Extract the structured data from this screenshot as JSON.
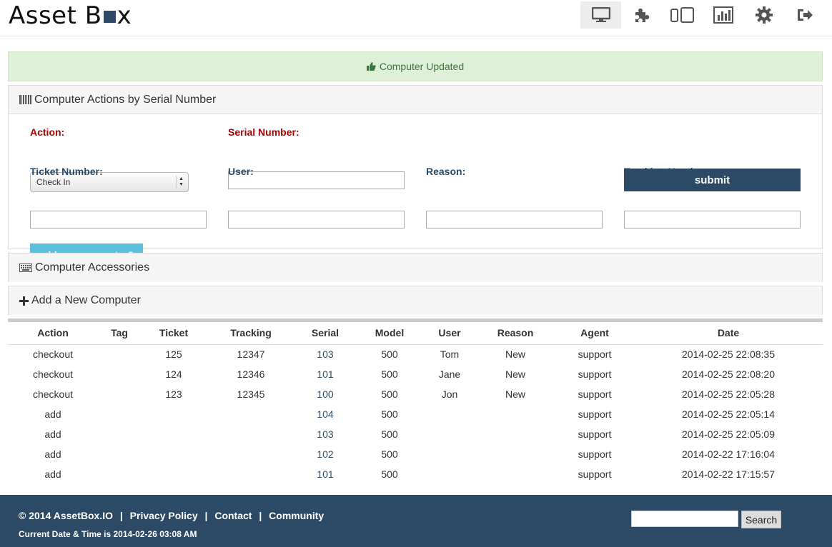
{
  "brand": {
    "name_prefix": "Asset B",
    "name_suffix": "x"
  },
  "nav": {
    "items": [
      {
        "icon": "desktop-icon",
        "active": true
      },
      {
        "icon": "puzzle-icon",
        "active": false
      },
      {
        "icon": "tablet-icon",
        "active": false
      },
      {
        "icon": "bar-chart-icon",
        "active": false
      },
      {
        "icon": "gear-icon",
        "active": false
      },
      {
        "icon": "sign-out-icon",
        "active": false
      }
    ]
  },
  "alert": {
    "text": "Computer Updated",
    "icon": "thumbs-up-icon",
    "color": "#3c763d",
    "background": "#dff0d8"
  },
  "panel_actions": {
    "title": "Computer Actions by Serial Number",
    "icon": "barcode-icon",
    "action_label": "Action:",
    "action_value": "Check In",
    "serial_label": "Serial Number:",
    "ticket_label": "Ticket Number:",
    "user_label": "User:",
    "reason_label": "Reason:",
    "tracking_label": "Tracking Number:",
    "submit_label": "submit",
    "add_label": "add new computer?"
  },
  "panel_accessories": {
    "title": "Computer Accessories",
    "icon": "keyboard-icon"
  },
  "panel_new": {
    "title": "Add a New Computer",
    "icon": "plus-icon"
  },
  "table": {
    "headers": [
      "Action",
      "Tag",
      "Ticket",
      "Tracking",
      "Serial",
      "Model",
      "User",
      "Reason",
      "Agent",
      "Date"
    ],
    "rows": [
      [
        "checkout",
        "",
        "125",
        "12347",
        "103",
        "500",
        "Tom",
        "New",
        "support",
        "2014-02-25 22:08:35"
      ],
      [
        "checkout",
        "",
        "124",
        "12346",
        "101",
        "500",
        "Jane",
        "New",
        "support",
        "2014-02-25 22:08:20"
      ],
      [
        "checkout",
        "",
        "123",
        "12345",
        "100",
        "500",
        "Jon",
        "New",
        "support",
        "2014-02-25 22:05:28"
      ],
      [
        "add",
        "",
        "",
        "",
        "104",
        "500",
        "",
        "",
        "support",
        "2014-02-25 22:05:14"
      ],
      [
        "add",
        "",
        "",
        "",
        "103",
        "500",
        "",
        "",
        "support",
        "2014-02-25 22:05:09"
      ],
      [
        "add",
        "",
        "",
        "",
        "102",
        "500",
        "",
        "",
        "support",
        "2014-02-22 17:16:04"
      ],
      [
        "add",
        "",
        "",
        "",
        "101",
        "500",
        "",
        "",
        "support",
        "2014-02-22 17:15:57"
      ]
    ]
  },
  "footer": {
    "copyright": "© 2014 AssetBox.IO",
    "privacy": "Privacy Policy",
    "contact": "Contact",
    "community": "Community",
    "separator": "|",
    "datetime": "Current Date & Time is 2014-02-26 03:08 AM",
    "search_button": "Search"
  },
  "colors": {
    "primary": "#2c4a66",
    "info": "#5bc0de",
    "required": "#aa0000"
  }
}
